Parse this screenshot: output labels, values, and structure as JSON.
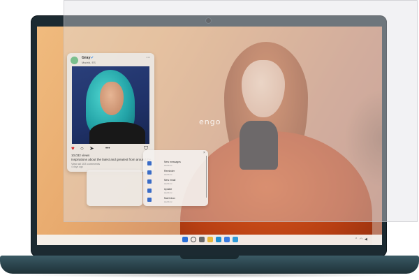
{
  "wallpaper": {
    "brand_text": "engo"
  },
  "social_post": {
    "username": "Gray",
    "verified_icon": "verified-badge-icon",
    "location": "Madrid, ES",
    "likes": "10,032 views",
    "caption_user": "Inspirations",
    "caption_text": "Inspirations about the latest and greatest from around the",
    "comments": "View all 103 comments",
    "time": "4 days ago",
    "icons": [
      "heart-icon",
      "comment-icon",
      "share-icon",
      "more-dots-icon",
      "bookmark-icon"
    ]
  },
  "notifications": {
    "items": [
      {
        "title": "New messages",
        "sub": "Aa bb cc"
      },
      {
        "title": "Reminder",
        "sub": "Aa bb cc"
      },
      {
        "title": "New email",
        "sub": "Aa bb cc"
      },
      {
        "title": "Update",
        "sub": "Aa bb cc"
      },
      {
        "title": "Mail Inbox",
        "sub": "Aa bb cc"
      }
    ]
  },
  "calendar": {
    "header": "",
    "days": [
      "",
      "",
      "",
      "",
      "",
      "",
      "",
      "",
      "",
      "",
      "",
      "",
      "",
      "",
      "",
      "",
      "",
      "",
      "",
      "",
      "",
      "",
      "",
      "",
      "",
      "",
      "",
      "",
      "",
      "",
      "",
      "",
      "",
      "",
      ""
    ]
  },
  "taskbar": {
    "clock_time": "",
    "clock_date": ""
  },
  "colors": {
    "accent": "#2a5fc7",
    "heart": "#d62828",
    "coat": "#c0461a",
    "laptop": "#1c2a31"
  }
}
